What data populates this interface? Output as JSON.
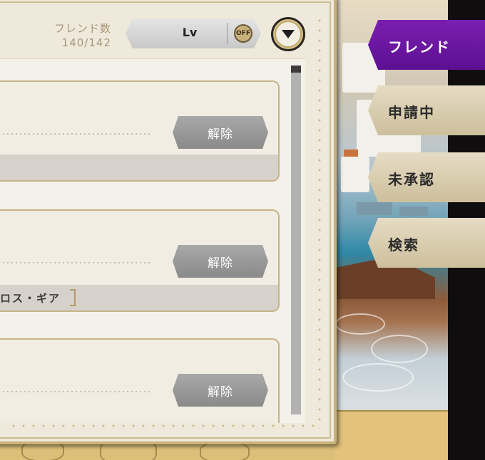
{
  "header": {
    "friend_count_label": "フレンド数",
    "friend_count_value": "140/142",
    "sort_label": "Lv",
    "order_toggle": "OFF"
  },
  "friends": [
    {
      "release_label": "解除",
      "footer_text": ""
    },
    {
      "release_label": "解除",
      "footer_text": "ロス・ギア"
    },
    {
      "release_label": "解除",
      "footer_text": ""
    }
  ],
  "tabs": [
    {
      "label": "フレンド",
      "active": true
    },
    {
      "label": "申請中",
      "active": false
    },
    {
      "label": "未承認",
      "active": false
    },
    {
      "label": "検索",
      "active": false
    }
  ],
  "icons": {
    "dropdown": "chevron-down-icon"
  },
  "colors": {
    "active_tab": "#6a16a1",
    "panel_border": "#c9b27a",
    "release_button": "#999999"
  }
}
